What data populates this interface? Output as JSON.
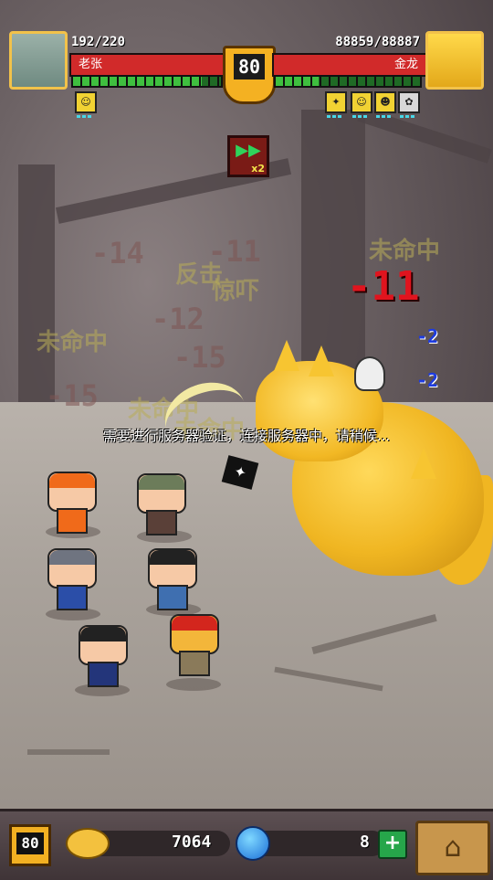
{
  "player": {
    "name": "老张",
    "hp": "192/220",
    "hp_fraction": 0.87
  },
  "enemy": {
    "name": "金龙",
    "hp": "88859/88887",
    "hp_fraction": 0.99
  },
  "level_badge": "80",
  "speed_button": {
    "label": "▶▶",
    "multiplier": "x2"
  },
  "combat_texts": {
    "faded": [
      "-14",
      "-11",
      "-12",
      "-15",
      "-15"
    ],
    "faded_words": [
      "反击",
      "惊吓",
      "未命中",
      "未命中",
      "未命中",
      "未命中"
    ],
    "red_damage": "-11",
    "blue_damage": [
      "-2",
      "-2"
    ]
  },
  "notice": "需要进行服务器验证，连接服务器中，请稍候...",
  "bottom_bar": {
    "level": "80",
    "coins": "7064",
    "gems": "8",
    "plus_label": "+",
    "home_icon": "home-icon"
  },
  "colors": {
    "hp_red": "#d12a2a",
    "stamina_green": "#3fbf3f",
    "gold": "#f2b022"
  }
}
